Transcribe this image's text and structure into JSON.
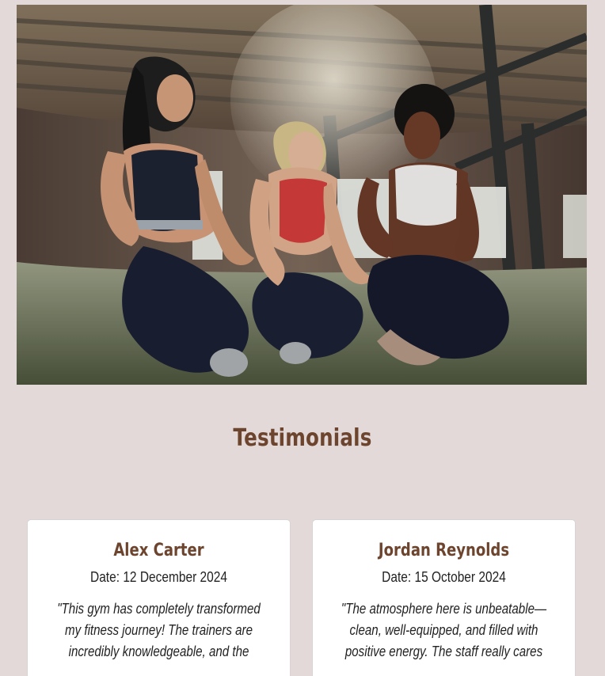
{
  "hero": {
    "alt": "Three women in athletic wear smiling together in an industrial gym space"
  },
  "testimonials": {
    "title": "Testimonials",
    "items": [
      {
        "name": "Alex Carter",
        "date": "Date: 12 December 2024",
        "quote": "\"This gym has completely transformed my fitness journey! The trainers are incredibly knowledgeable, and the"
      },
      {
        "name": "Jordan Reynolds",
        "date": "Date: 15 October 2024",
        "quote": "\"The atmosphere here is unbeatable—clean, well-equipped, and filled with positive energy. The staff really cares"
      }
    ]
  },
  "colors": {
    "page_background": "#e3d9d9",
    "heading_brown": "#6d452f",
    "card_background": "#ffffff"
  }
}
